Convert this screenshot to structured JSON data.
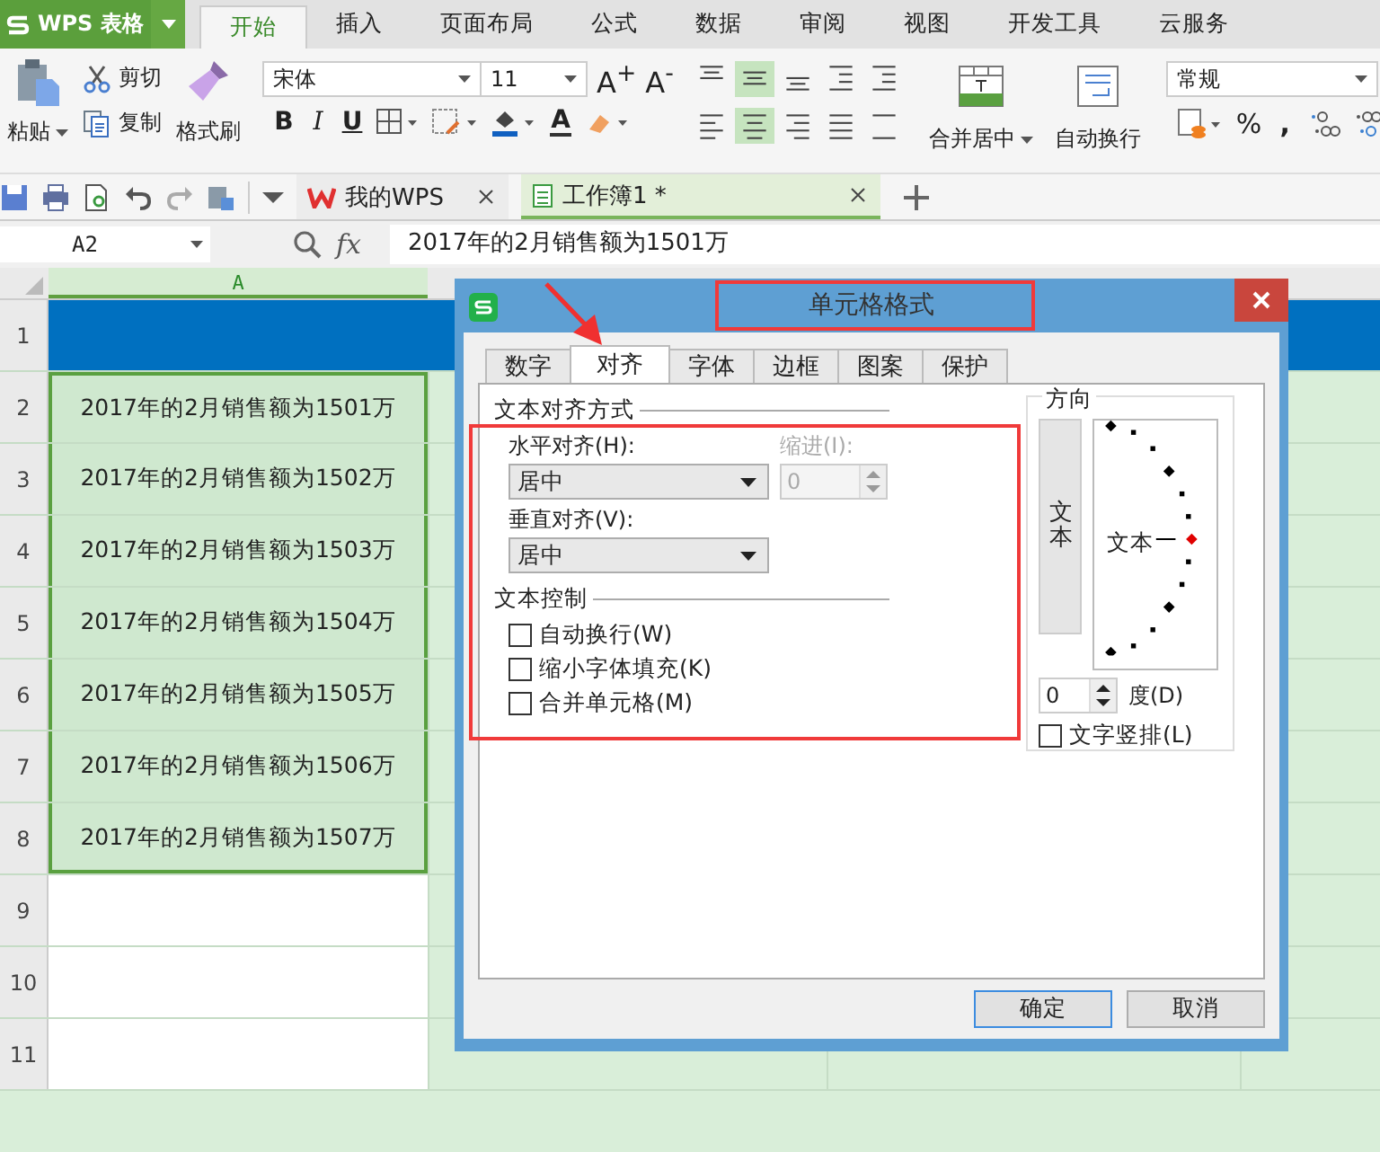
{
  "app_menu": {
    "label": "WPS 表格"
  },
  "ribbon_tabs": [
    {
      "label": "开始",
      "selected": true
    },
    {
      "label": "插入",
      "selected": false
    },
    {
      "label": "页面布局",
      "selected": false
    },
    {
      "label": "公式",
      "selected": false
    },
    {
      "label": "数据",
      "selected": false
    },
    {
      "label": "审阅",
      "selected": false
    },
    {
      "label": "视图",
      "selected": false
    },
    {
      "label": "开发工具",
      "selected": false
    },
    {
      "label": "云服务",
      "selected": false
    }
  ],
  "ribbon": {
    "clipboard": {
      "paste": "粘贴",
      "cut": "剪切",
      "copy": "复制",
      "format_painter": "格式刷"
    },
    "font": {
      "name": "宋体",
      "size": "11",
      "grow": "A$^{+}$",
      "shrink": "A$^{-}$",
      "bold": "B",
      "italic": "I",
      "underline": "U",
      "font_color": "A"
    },
    "alignment_buttons": [
      {
        "kind": "top",
        "selected": false
      },
      {
        "kind": "middle",
        "selected": true
      },
      {
        "kind": "bottom",
        "selected": false
      },
      {
        "kind": "outdent",
        "selected": false
      },
      {
        "kind": "indent",
        "selected": false
      },
      {
        "kind": "left",
        "selected": false
      },
      {
        "kind": "center",
        "selected": true
      },
      {
        "kind": "right",
        "selected": false
      },
      {
        "kind": "justify",
        "selected": false
      },
      {
        "kind": "distributed",
        "selected": false
      }
    ],
    "merge": "合并居中",
    "wrap": "自动换行",
    "number": {
      "format": "常规",
      "percent": "%",
      "comma": ","
    }
  },
  "doc_tabs": [
    {
      "label": "我的WPS",
      "selected": false
    },
    {
      "label": "工作簿1 *",
      "selected": true
    }
  ],
  "formula_bar": {
    "name_box": "A2",
    "fx": "fx",
    "formula": "2017年的2月销售额为1501万"
  },
  "sheet": {
    "columns": [
      {
        "label": "A",
        "selected": true
      }
    ],
    "rows": [
      {
        "number": "1"
      },
      {
        "number": "2",
        "cell": "2017年的2月销售额为1501万"
      },
      {
        "number": "3",
        "cell": "2017年的2月销售额为1502万"
      },
      {
        "number": "4",
        "cell": "2017年的2月销售额为1503万"
      },
      {
        "number": "5",
        "cell": "2017年的2月销售额为1504万"
      },
      {
        "number": "6",
        "cell": "2017年的2月销售额为1505万"
      },
      {
        "number": "7",
        "cell": "2017年的2月销售额为1506万"
      },
      {
        "number": "8",
        "cell": "2017年的2月销售额为1507万"
      },
      {
        "number": "9"
      },
      {
        "number": "10"
      },
      {
        "number": "11"
      }
    ]
  },
  "dialog": {
    "title": "单元格格式",
    "tabs": [
      {
        "label": "数字",
        "selected": false
      },
      {
        "label": "对齐",
        "selected": true
      },
      {
        "label": "字体",
        "selected": false
      },
      {
        "label": "边框",
        "selected": false
      },
      {
        "label": "图案",
        "selected": false
      },
      {
        "label": "保护",
        "selected": false
      }
    ],
    "alignment_section": "文本对齐方式",
    "horizontal": {
      "label": "水平对齐(H):",
      "value": "居中"
    },
    "indent": {
      "label": "缩进(I):",
      "value": "0",
      "disabled": true
    },
    "vertical": {
      "label": "垂直对齐(V):",
      "value": "居中"
    },
    "control_section": "文本控制",
    "checkboxes": [
      {
        "label": "自动换行(W)",
        "checked": false
      },
      {
        "label": "缩小字体填充(K)",
        "checked": false
      },
      {
        "label": "合并单元格(M)",
        "checked": false
      }
    ],
    "orientation": {
      "title": "方向",
      "vertical_text": "文本",
      "dial_text": "文本",
      "degrees": "0",
      "degree_label": "度(D)",
      "vertical_checkbox": {
        "label": "文字竖排(L)",
        "checked": false
      }
    },
    "buttons": [
      {
        "label": "确定",
        "default": true
      },
      {
        "label": "取消",
        "default": false
      }
    ]
  }
}
